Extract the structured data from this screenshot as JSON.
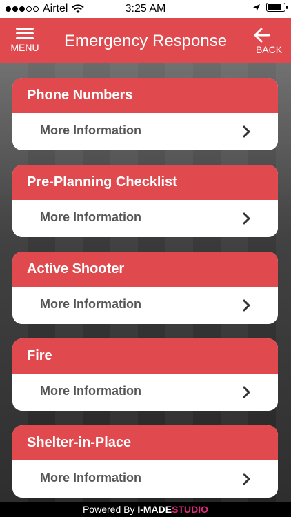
{
  "status_bar": {
    "carrier": "Airtel",
    "time": "3:25 AM",
    "signal_filled": 3,
    "signal_total": 5,
    "battery_level": 0.85
  },
  "header": {
    "title": "Emergency Response",
    "menu_label": "MENU",
    "back_label": "BACK",
    "bg_color": "#e0494d"
  },
  "cards": [
    {
      "title": "Phone Numbers",
      "more": "More Information"
    },
    {
      "title": "Pre-Planning Checklist",
      "more": "More Information"
    },
    {
      "title": "Active Shooter",
      "more": "More Information"
    },
    {
      "title": "Fire",
      "more": "More Information"
    },
    {
      "title": "Shelter-in-Place",
      "more": "More Information"
    }
  ],
  "footer": {
    "powered_by": "Powered By",
    "brand": "I-MADE",
    "studio": "STUDIO"
  }
}
